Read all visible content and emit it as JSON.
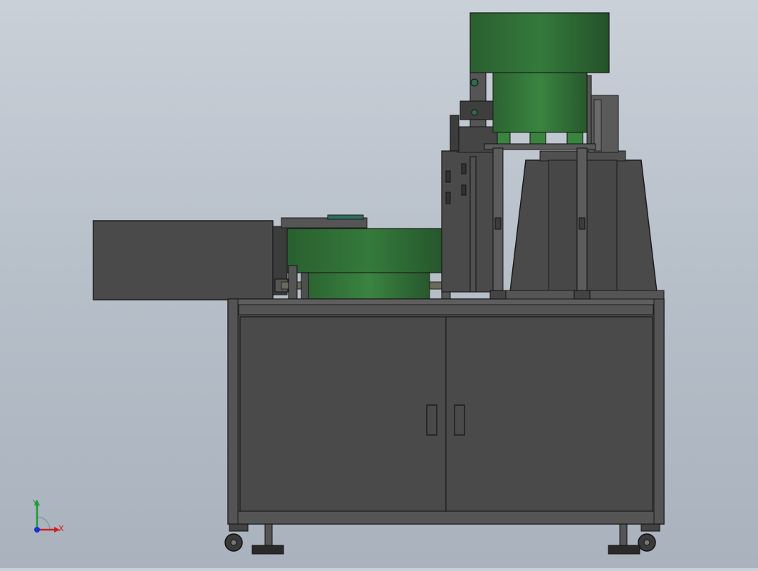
{
  "view": {
    "background_top": "#c9d0d8",
    "background_bottom": "#a9b2bd",
    "part_color": "#4b4b4b",
    "bowl_color": "#2f6b35"
  },
  "triad": {
    "x_label": "X",
    "y_label": "Y",
    "x_color": "#cc1f1f",
    "y_color": "#1f9a3a",
    "z_color": "#1f2fd0"
  }
}
